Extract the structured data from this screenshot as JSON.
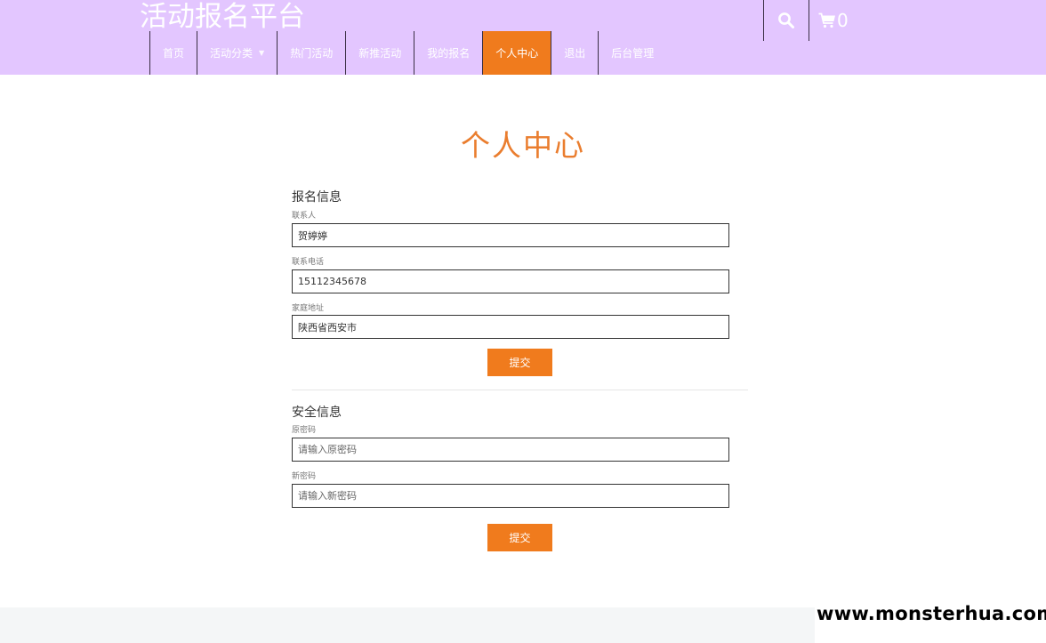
{
  "header": {
    "brand": "活动报名平台",
    "nav": [
      {
        "label": "首页",
        "active": false
      },
      {
        "label": "活动分类",
        "active": false,
        "dropdown": true
      },
      {
        "label": "热门活动",
        "active": false
      },
      {
        "label": "新推活动",
        "active": false
      },
      {
        "label": "我的报名",
        "active": false
      },
      {
        "label": "个人中心",
        "active": true
      },
      {
        "label": "退出",
        "active": false
      },
      {
        "label": "后台管理",
        "active": false
      }
    ],
    "search_icon": "search-icon",
    "cart_icon": "cart-icon",
    "cart_count": "0"
  },
  "page": {
    "title": "个人中心"
  },
  "signup_info": {
    "section_title": "报名信息",
    "contact_label": "联系人",
    "contact_value": "贺婷婷",
    "phone_label": "联系电话",
    "phone_value": "15112345678",
    "address_label": "家庭地址",
    "address_value": "陕西省西安市",
    "submit_label": "提交"
  },
  "security_info": {
    "section_title": "安全信息",
    "old_password_label": "原密码",
    "old_password_placeholder": "请输入原密码",
    "new_password_label": "新密码",
    "new_password_placeholder": "请输入新密码",
    "submit_label": "提交"
  },
  "watermark": "www.monsterhua.com",
  "colors": {
    "header_bg": "#e3c6ff",
    "accent": "#f07b1d",
    "title": "#ea7d2e"
  }
}
